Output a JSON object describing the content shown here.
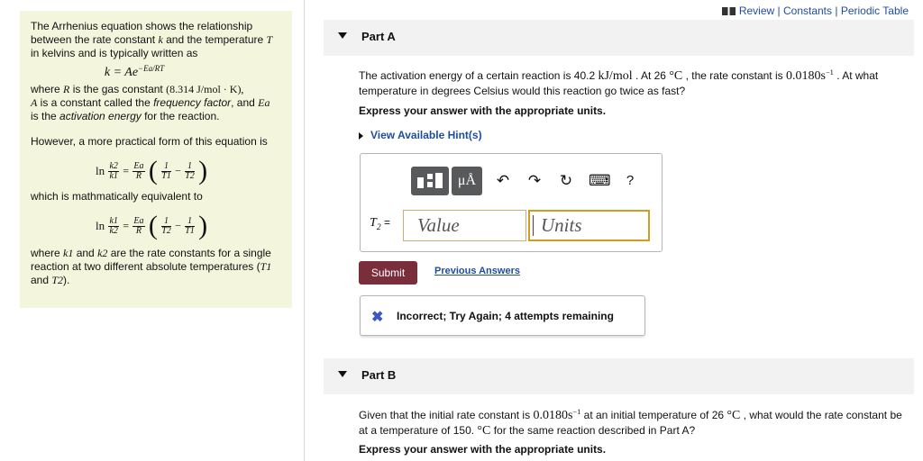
{
  "top_links": {
    "review": "Review",
    "sep1": "|",
    "constants": "Constants",
    "sep2": "|",
    "periodic": "Periodic Table"
  },
  "intro": {
    "p1_a": "The Arrhenius equation shows the relationship between the rate constant ",
    "p1_k": "k",
    "p1_b": " and the temperature ",
    "p1_T": "T",
    "p1_c": " in kelvins and is typically written as",
    "eq_main_lhs": "k = Ae",
    "eq_main_exp": "−Ea/RT",
    "p2_a": "where ",
    "p2_R": "R",
    "p2_b": " is the gas constant ",
    "p2_Rval": "(8.314 J/mol · K),",
    "p2_A": "A",
    "p2_c": " is a constant called the ",
    "p2_ff": "frequency factor",
    "p2_d": ", and ",
    "p2_Ea": "Ea",
    "p2_e": " is the ",
    "p2_ae": "activation energy",
    "p2_f": " for the reaction.",
    "p3": "However, a more practical form of this equation is",
    "eq1_ln": "ln",
    "eq1_k_num": "k2",
    "eq1_k_den": "k1",
    "eq1_Ea": "Ea",
    "eq1_R": "R",
    "eq1_one_a": "1",
    "eq1_T1": "T1",
    "eq1_one_b": "1",
    "eq1_T2": "T2",
    "p4": "which is mathmatically equivalent to",
    "eq2_k_num": "k1",
    "eq2_k_den": "k2",
    "eq2_T1": "T2",
    "eq2_T2": "T1",
    "p5_a": "where ",
    "p5_k1": "k1",
    "p5_b": " and ",
    "p5_k2": "k2",
    "p5_c": " are the rate constants for a single reaction at two different absolute temperatures (",
    "p5_T1": "T1",
    "p5_d": " and ",
    "p5_T2": "T2",
    "p5_e": ")."
  },
  "partA": {
    "title": "Part A",
    "q_a": "The activation energy of a certain reaction is 40.2 ",
    "q_unit": "kJ/mol",
    "q_b": " . At 26  ",
    "q_degC": "°C",
    "q_c": " , the rate constant is ",
    "q_k": "0.0180s",
    "q_kexp": "−1",
    "q_d": " . At what temperature in degrees Celsius would this reaction go twice as fast?",
    "instruction": "Express your answer with the appropriate units.",
    "hint": "View Available Hint(s)",
    "toolbar": {
      "mu": "μÅ",
      "undo": "↶",
      "redo": "↷",
      "reset": "↻",
      "keyboard": "⌨",
      "help": "?"
    },
    "answer_label": "T",
    "answer_label_sub": "2",
    "answer_eq": " =",
    "value_placeholder": "Value",
    "units_placeholder": "Units",
    "submit": "Submit",
    "previous": "Previous Answers",
    "feedback_icon": "✖",
    "feedback": "Incorrect; Try Again; 4 attempts remaining"
  },
  "partB": {
    "title": "Part B",
    "q_a": "Given that the initial rate constant is ",
    "q_k": "0.0180s",
    "q_kexp": "−1",
    "q_b": " at an initial temperature of 26  ",
    "q_degC": "°C",
    "q_c": " , what would the rate constant be at a temperature of 150.  ",
    "q_degC2": "°C",
    "q_d": " for the same reaction described in Part A?",
    "instruction": "Express your answer with the appropriate units."
  },
  "colors": {
    "intro_bg": "#f3f5dd",
    "link": "#1f4e99",
    "submit_bg": "#7a2d3a",
    "units_border": "#d39b23",
    "feedback_x": "#3b59c5"
  }
}
